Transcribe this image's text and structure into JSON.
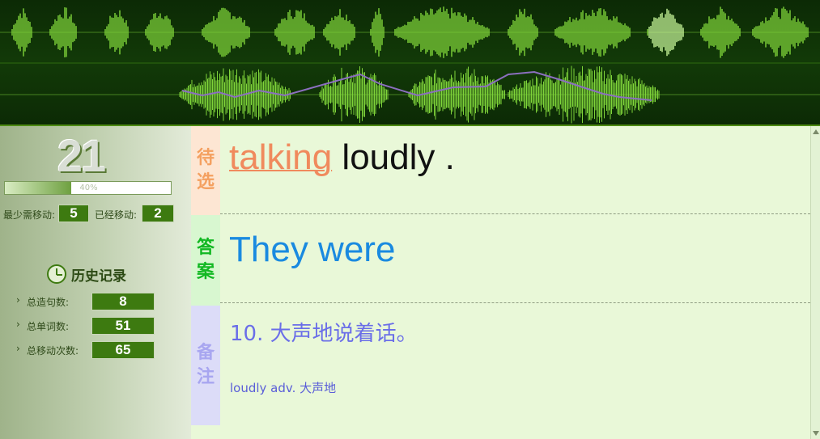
{
  "waveform": {
    "colors": {
      "background": "#0c2a05",
      "wave": "#7fd43a",
      "wave_highlight": "#c8f79a",
      "pitch": "#8b6fbf"
    }
  },
  "sidebar": {
    "count": "21",
    "progress": {
      "percent": 40,
      "label": "40%"
    },
    "min_moves_label": "最少需移动:",
    "min_moves_value": "5",
    "moved_label": "已经移动:",
    "moved_value": "2",
    "history": {
      "title": "历史记录",
      "icon": "clock-icon",
      "rows": [
        {
          "label": "总造句数:",
          "value": "8"
        },
        {
          "label": "总单词数:",
          "value": "51"
        },
        {
          "label": "总移动次数:",
          "value": "65"
        }
      ]
    }
  },
  "main": {
    "pending": {
      "tag": [
        "待",
        "选"
      ],
      "words": [
        {
          "text": "talking",
          "highlighted": true
        },
        {
          "text": "loudly",
          "highlighted": false
        },
        {
          "text": ".",
          "highlighted": false
        }
      ]
    },
    "answer": {
      "tag": [
        "答",
        "案"
      ],
      "text": "They were"
    },
    "notes": {
      "tag": [
        "备",
        "注"
      ],
      "main": "10. 大声地说着话。",
      "vocab": "loudly adv. 大声地"
    }
  }
}
